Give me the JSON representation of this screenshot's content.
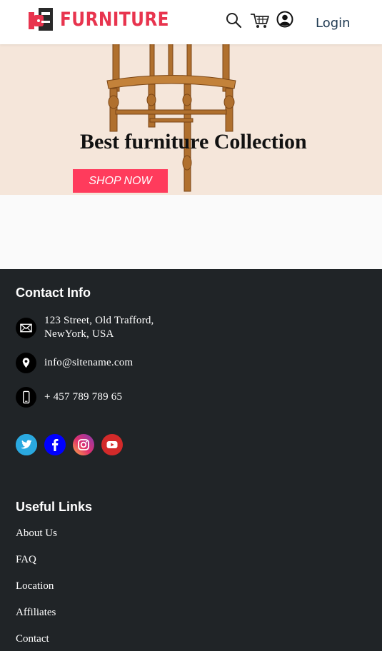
{
  "header": {
    "brand": "FURNITURE",
    "login_label": "Login",
    "icons": [
      "search-icon",
      "cart-icon",
      "user-account-icon"
    ]
  },
  "hero": {
    "title": "Best furniture Collection",
    "cta_label": "SHOP NOW"
  },
  "footer": {
    "contact_heading": "Contact Info",
    "address_line1": "123 Street, Old Trafford,",
    "address_line2": "NewYork, USA",
    "email": "info@sitename.com",
    "phone": "+ 457 789 789 65",
    "social": [
      "twitter-icon",
      "facebook-icon",
      "instagram-icon",
      "youtube-icon"
    ],
    "links_heading": "Useful Links",
    "links": [
      "About Us",
      "FAQ",
      "Location",
      "Affiliates",
      "Contact"
    ]
  },
  "colors": {
    "brand_red": "#e8344e",
    "cta_pink": "#ff3b5c",
    "footer_bg": "#202427",
    "hero_bg": "#f5e6da",
    "login_text": "#1f3a52"
  }
}
